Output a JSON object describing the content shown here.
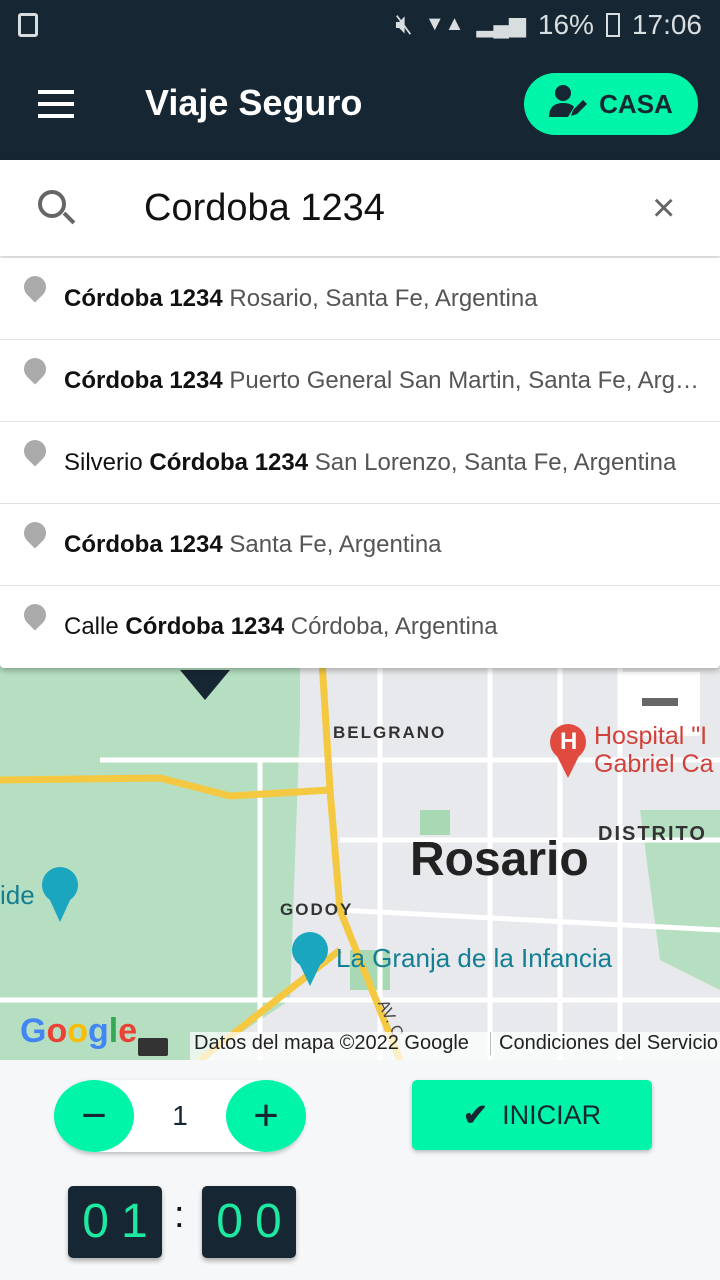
{
  "status": {
    "battery": "16%",
    "time": "17:06"
  },
  "appbar": {
    "title": "Viaje Seguro",
    "casa_label": "CASA"
  },
  "search": {
    "value": "Cordoba 1234",
    "clear": "×"
  },
  "suggestions": [
    {
      "prefix": "",
      "bold": "Córdoba 1234",
      "rest": " Rosario, Santa Fe, Argentina"
    },
    {
      "prefix": "",
      "bold": "Córdoba 1234",
      "rest": " Puerto General San Martin, Santa Fe, Argentina"
    },
    {
      "prefix": "Silverio ",
      "bold": "Córdoba 1234",
      "rest": " San Lorenzo, Santa Fe, Argentina"
    },
    {
      "prefix": "",
      "bold": "Córdoba 1234",
      "rest": " Santa Fe, Argentina"
    },
    {
      "prefix": "Calle ",
      "bold": "Córdoba 1234",
      "rest": " Córdoba, Argentina"
    }
  ],
  "map": {
    "labels": {
      "belgrano": "BELGRANO",
      "hospital1": "Hospital \"I",
      "hospital2": "Gabriel Ca",
      "distrito": "DISTRITO",
      "rosario": "Rosario",
      "godoy": "GODOY",
      "granja": "La Granja de la Infancia",
      "ide": "ide",
      "av": "AV. C"
    },
    "attribution": "Datos del mapa ©2022 Google",
    "terms": "Condiciones del Servicio",
    "logo": "Google"
  },
  "controls": {
    "minus": "−",
    "count": "1",
    "plus": "+",
    "start_label": "INICIAR",
    "hours": "01",
    "minutes": "00",
    "colon": ":"
  },
  "colors": {
    "primary": "#162733",
    "accent": "#00f5a8"
  }
}
